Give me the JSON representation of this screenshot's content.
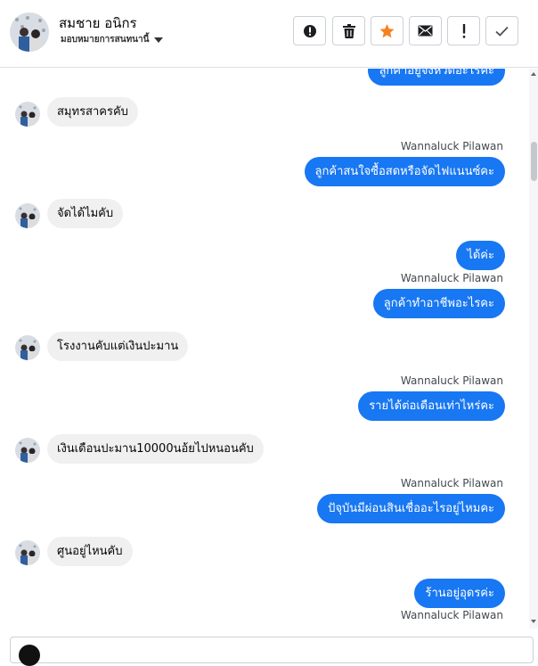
{
  "header": {
    "contact_name": "สมชาย อนิกร",
    "assign_label": "มอบหมายการสนทนานี้",
    "buttons": [
      {
        "icon": "alert-circle-icon"
      },
      {
        "icon": "trash-icon"
      },
      {
        "icon": "star-icon",
        "color": "#f5821f"
      },
      {
        "icon": "envelope-icon"
      },
      {
        "icon": "exclamation-icon"
      },
      {
        "icon": "check-icon"
      }
    ]
  },
  "messages": {
    "m0": {
      "text": "ลูกค้าอยู่จังหวัดอะไรคะ"
    },
    "m1": {
      "text": "สมุทรสาครคับ"
    },
    "m2": {
      "sender": "Wannaluck Pilawan",
      "text": "ลูกค้าสนใจซื้อสดหรือจัดไฟแนนซ์คะ"
    },
    "m3": {
      "text": "จัดได้ไมคับ"
    },
    "m4": {
      "text": "ได้ค่ะ"
    },
    "m5": {
      "sender": "Wannaluck Pilawan",
      "text": "ลูกค้าทำอาชีพอะไรคะ"
    },
    "m6": {
      "text": "โรงงานคับแต่เงินปะมาน"
    },
    "m7": {
      "sender": "Wannaluck Pilawan",
      "text": "รายได้ต่อเดือนเท่าไหร่คะ"
    },
    "m8": {
      "text": "เงินเดือนปะมาน10000นอ้ยไปหนอนคับ"
    },
    "m9": {
      "sender": "Wannaluck Pilawan",
      "text": "ปัจุบันมีผ่อนสินเชื่ออะไรอยู่ไหมคะ"
    },
    "m10": {
      "text": "ศูนอยู่ไหนคับ"
    },
    "m11": {
      "text": "ร้านอยู่อุดรค่ะ"
    },
    "m12": {
      "sender": "Wannaluck Pilawan"
    }
  },
  "colors": {
    "outgoing_bubble": "#1877f2",
    "incoming_bubble": "#f0f0f0",
    "star": "#f5821f"
  }
}
